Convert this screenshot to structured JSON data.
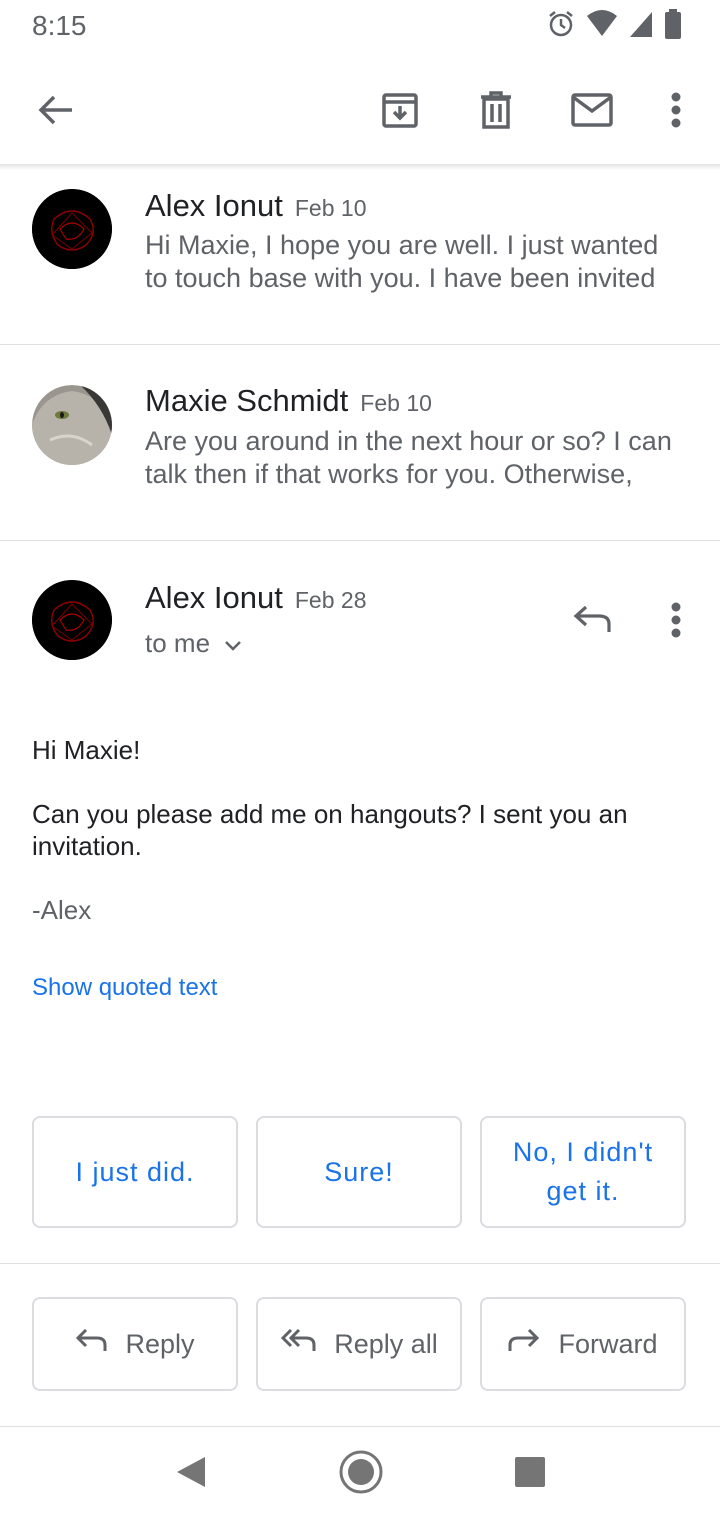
{
  "status_bar": {
    "time": "8:15",
    "icons": [
      "alarm-icon",
      "wifi-icon",
      "cell-signal-icon",
      "battery-icon"
    ]
  },
  "toolbar": {
    "icons": [
      "back-arrow-icon",
      "archive-icon",
      "delete-icon",
      "mark-unread-icon",
      "more-vert-icon"
    ]
  },
  "thread": [
    {
      "sender": "Alex Ionut",
      "date": "Feb 10",
      "snippet": "Hi Maxie, I hope you are well. I just wanted to touch base with you. I have been invited"
    },
    {
      "sender": "Maxie Schmidt",
      "date": "Feb 10",
      "snippet": "Are you around in the next hour or so? I can talk then if that works for you. Otherwise,"
    }
  ],
  "open_message": {
    "sender": "Alex Ionut",
    "date": "Feb 28",
    "recipient": "to me",
    "greeting": "Hi Maxie!",
    "body": "Can you please add me on hangouts? I sent you an invitation.",
    "signature": "-Alex",
    "show_quoted": "Show quoted text"
  },
  "smart_replies": [
    "I just did.",
    "Sure!",
    "No, I didn't get it."
  ],
  "actions": {
    "reply": "Reply",
    "reply_all": "Reply all",
    "forward": "Forward"
  },
  "colors": {
    "accent": "#1a73e8",
    "secondary_text": "#5f6368",
    "primary_text": "#202124",
    "border": "#dadce0"
  }
}
